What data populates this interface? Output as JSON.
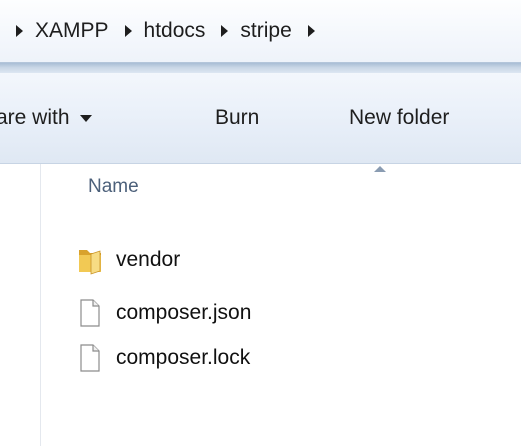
{
  "breadcrumb": {
    "items": [
      "XAMPP",
      "htdocs",
      "stripe"
    ]
  },
  "toolbar": {
    "share_label": "are with",
    "burn_label": "Burn",
    "new_folder_label": "New folder"
  },
  "file_list": {
    "column_header": "Name",
    "sort_direction": "ascending",
    "items": [
      {
        "name": "vendor",
        "type": "folder",
        "icon": "folder-icon"
      },
      {
        "name": "composer.json",
        "type": "file",
        "icon": "file-icon"
      },
      {
        "name": "composer.lock",
        "type": "file",
        "icon": "file-icon"
      }
    ]
  },
  "colors": {
    "folder": "#e9b73a",
    "toolbar_bg": "#e7eef8",
    "header_text": "#4c607a"
  }
}
